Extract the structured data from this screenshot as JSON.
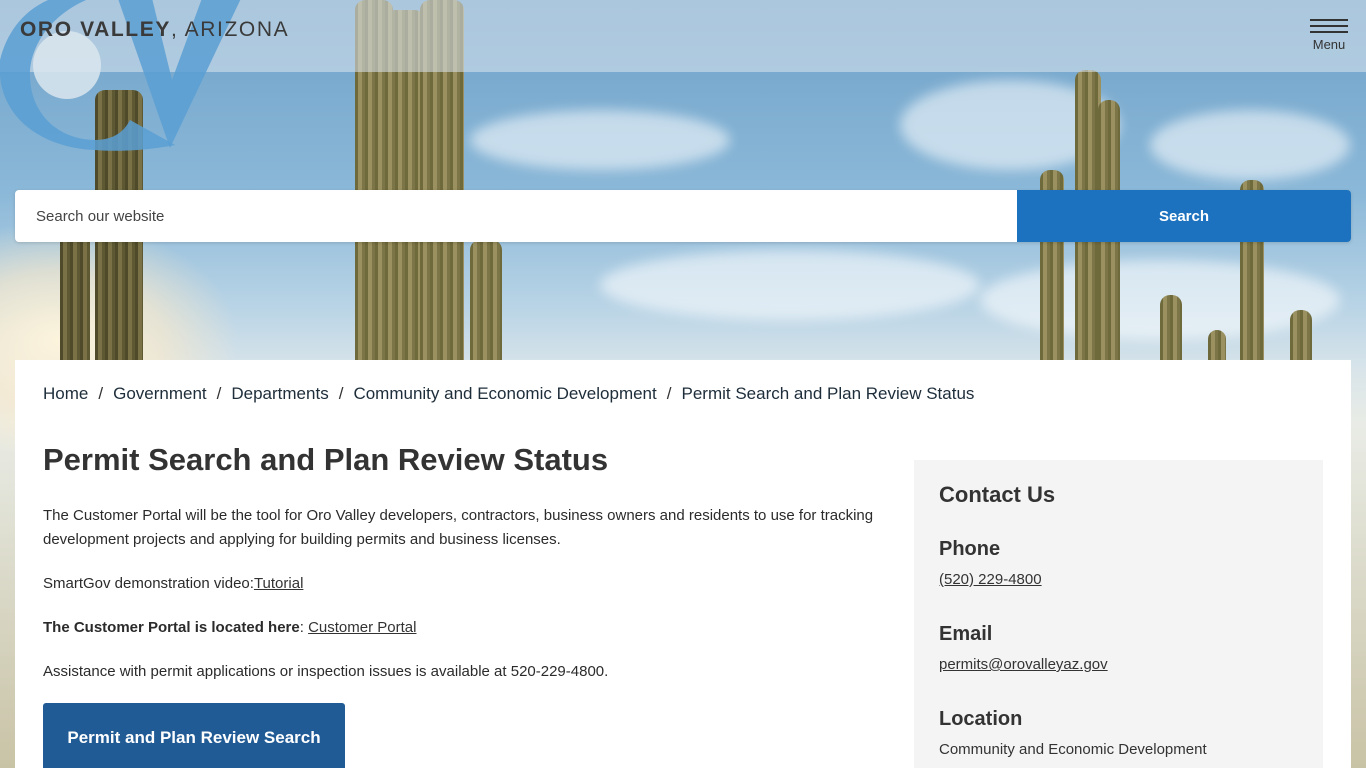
{
  "header": {
    "logo_bold": "ORO VALLEY",
    "logo_rest": ", ARIZONA",
    "menu_label": "Menu"
  },
  "search": {
    "placeholder": "Search our website",
    "button_label": "Search"
  },
  "breadcrumb": [
    {
      "label": "Home"
    },
    {
      "label": "Government"
    },
    {
      "label": "Departments"
    },
    {
      "label": "Community and Economic Development"
    },
    {
      "label": "Permit Search and Plan Review Status"
    }
  ],
  "breadcrumb_sep": "/",
  "main": {
    "title": "Permit Search and Plan Review Status",
    "intro": "The Customer Portal will be the tool for Oro Valley developers, contractors, business owners and residents to use for tracking development projects and applying for building permits and business licenses.",
    "demo_prefix": "SmartGov demonstration video:",
    "demo_link": "Tutorial",
    "portal_bold": "The Customer Portal is located here",
    "portal_colon": ": ",
    "portal_link": "Customer Portal",
    "assistance": "Assistance with permit applications or inspection issues is available at 520-229-4800.",
    "cta_label": "Permit and Plan Review Search"
  },
  "sidebar": {
    "title": "Contact Us",
    "phone_heading": "Phone",
    "phone_value": "(520) 229-4800",
    "email_heading": "Email",
    "email_value": "permits@orovalleyaz.gov",
    "location_heading": "Location",
    "location_value": "Community and Economic Development"
  },
  "colors": {
    "search_button": "#1c72be",
    "cta_button": "#215b96",
    "logo_mark": "#5b9fd4"
  },
  "icons": [
    "oro-valley-logo-mark",
    "hamburger-menu-icon"
  ]
}
